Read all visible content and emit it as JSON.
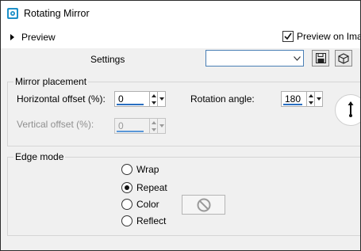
{
  "window": {
    "title": "Rotating Mirror",
    "icon": "app-icon",
    "accent_color": "#1e90c8"
  },
  "preview": {
    "toggle_label": "Preview",
    "preview_on_label": "Preview on Imag",
    "preview_on_checked": true
  },
  "settings": {
    "label": "Settings",
    "select_value": "",
    "save_icon": "floppy-disk-icon",
    "preset_icon": "cube-icon"
  },
  "mirror_placement": {
    "title": "Mirror placement",
    "horizontal_offset": {
      "label": "Horizontal offset (%):",
      "value": "0",
      "enabled": true
    },
    "vertical_offset": {
      "label": "Vertical offset (%):",
      "value": "0",
      "enabled": false
    },
    "rotation_angle": {
      "label": "Rotation angle:",
      "value": "180"
    },
    "dial_icon": "angle-dial-icon"
  },
  "edge_mode": {
    "title": "Edge mode",
    "options": [
      {
        "label": "Wrap",
        "selected": false
      },
      {
        "label": "Repeat",
        "selected": true
      },
      {
        "label": "Color",
        "selected": false
      },
      {
        "label": "Reflect",
        "selected": false
      }
    ],
    "color_swatch_icon": "no-symbol-icon"
  }
}
